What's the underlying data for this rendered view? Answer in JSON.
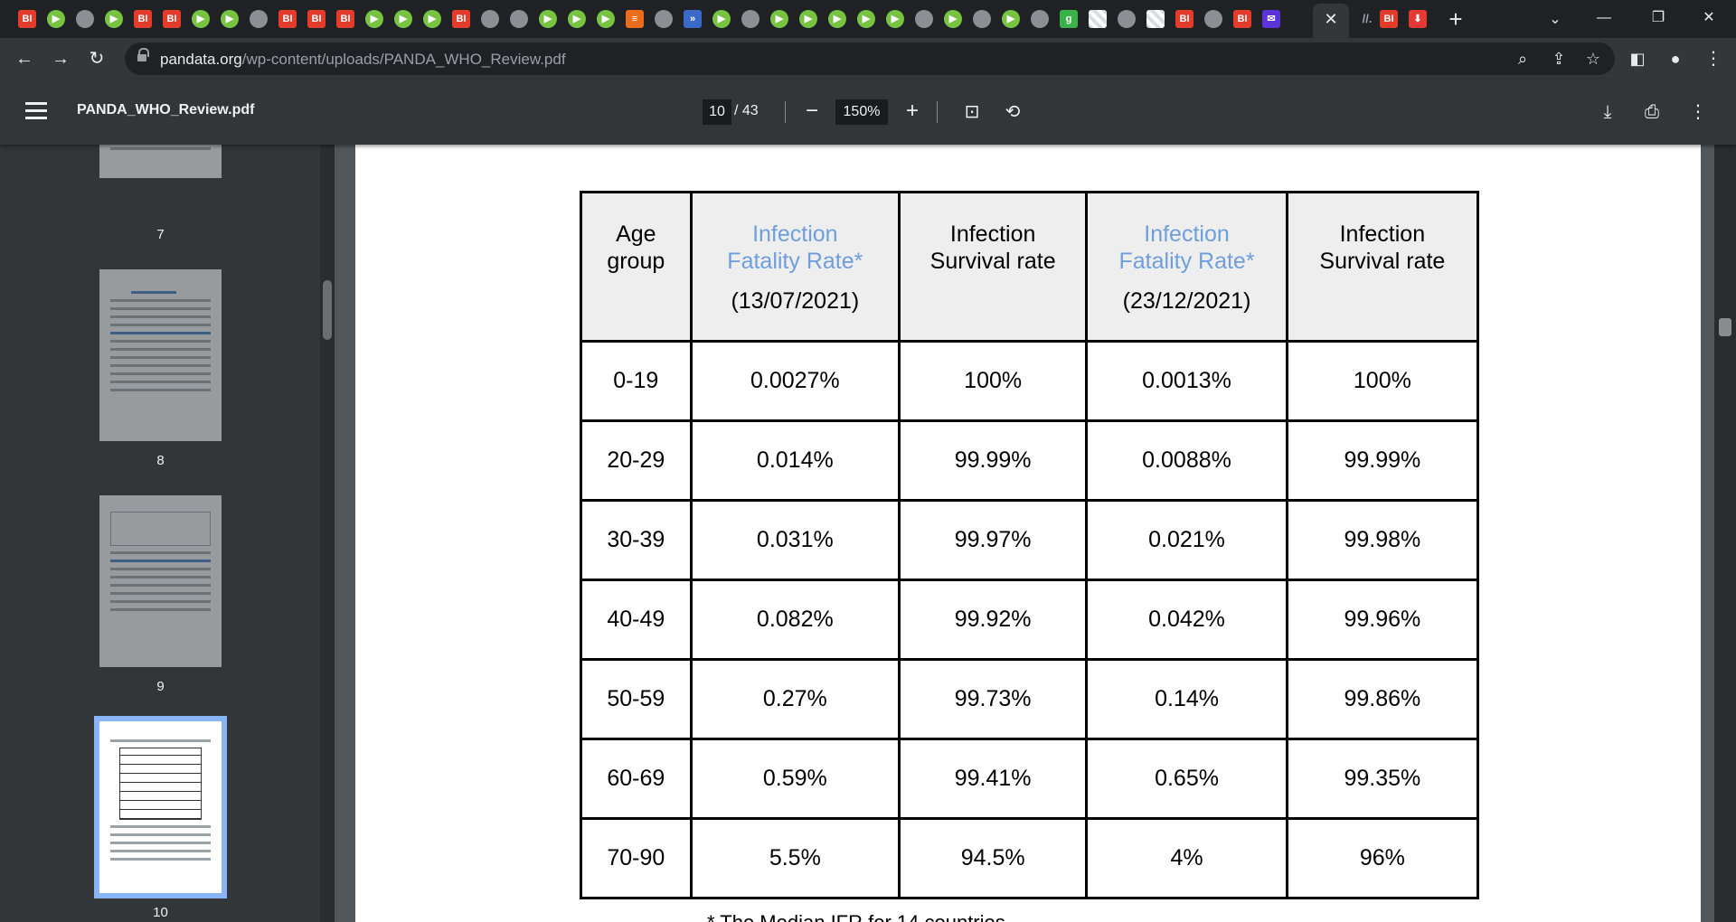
{
  "browser": {
    "active_tab_close": "✕",
    "new_tab": "+",
    "address": {
      "host": "pandata.org",
      "path": "/wp-content/uploads/PANDA_WHO_Review.pdf"
    }
  },
  "viewer": {
    "file_name": "PANDA_WHO_Review.pdf",
    "current_page": "10",
    "page_total": "/ 43",
    "zoom": "150%"
  },
  "thumbnails": [
    {
      "label": "7"
    },
    {
      "label": "8"
    },
    {
      "label": "9"
    },
    {
      "label": "10",
      "active": true
    }
  ],
  "table": {
    "headers": [
      {
        "line1": "Age",
        "line2": "group",
        "blue": false,
        "date": ""
      },
      {
        "line1": "Infection",
        "line2": "Fatality Rate*",
        "blue": true,
        "date": "(13/07/2021)"
      },
      {
        "line1": "Infection",
        "line2": "Survival rate",
        "blue": false,
        "date": ""
      },
      {
        "line1": "Infection",
        "line2": "Fatality Rate*",
        "blue": true,
        "date": "(23/12/2021)"
      },
      {
        "line1": "Infection",
        "line2": "Survival rate",
        "blue": false,
        "date": ""
      }
    ],
    "rows": [
      [
        "0-19",
        "0.0027%",
        "100%",
        "0.0013%",
        "100%"
      ],
      [
        "20-29",
        "0.014%",
        "99.99%",
        "0.0088%",
        "99.99%"
      ],
      [
        "30-39",
        "0.031%",
        "99.97%",
        "0.021%",
        "99.98%"
      ],
      [
        "40-49",
        "0.082%",
        "99.92%",
        "0.042%",
        "99.96%"
      ],
      [
        "50-59",
        "0.27%",
        "99.73%",
        "0.14%",
        "99.86%"
      ],
      [
        "60-69",
        "0.59%",
        "99.41%",
        "0.65%",
        "99.35%"
      ],
      [
        "70-90",
        "5.5%",
        "94.5%",
        "4%",
        "96%"
      ]
    ],
    "footnote": "* The Median IFR for 14 countries",
    "accent_color": "#6e9fdc"
  }
}
